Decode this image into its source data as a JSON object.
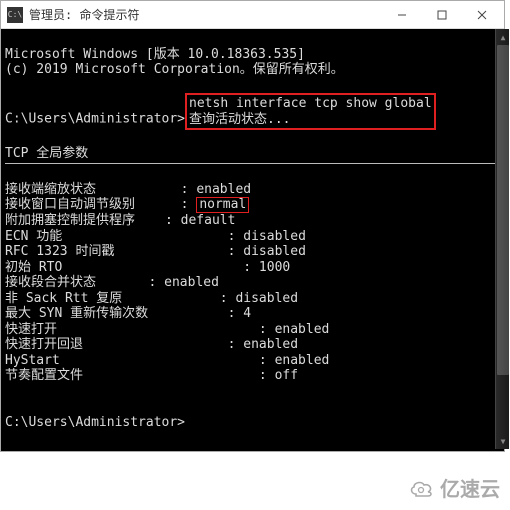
{
  "window": {
    "title": "管理员: 命令提示符"
  },
  "banner": {
    "line1": "Microsoft Windows [版本 10.0.18363.535]",
    "line2": "(c) 2019 Microsoft Corporation。保留所有权利。"
  },
  "prompt": {
    "path": "C:\\Users\\Administrator>",
    "command": "netsh interface tcp show global",
    "status_line": "查询活动状态..."
  },
  "section_header": "TCP 全局参数",
  "rows": {
    "r0_label": "接收端缩放状态",
    "r0_val": "enabled",
    "r1_label": "接收窗口自动调节级别",
    "r1_val": "normal",
    "r2_label": "附加拥塞控制提供程序",
    "r2_val": "default",
    "r3_label": "ECN 功能",
    "r3_val": "disabled",
    "r4_label": "RFC 1323 时间戳",
    "r4_val": "disabled",
    "r5_label": "初始 RTO",
    "r5_val": "1000",
    "r6_label": "接收段合并状态",
    "r6_val": "enabled",
    "r7_label": "非 Sack Rtt 复原",
    "r7_val": "disabled",
    "r8_label": "最大 SYN 重新传输次数",
    "r8_val": "4",
    "r9_label": "快速打开",
    "r9_val": "enabled",
    "r10_label": "快速打开回退",
    "r10_val": "enabled",
    "r11_label": "HyStart",
    "r11_val": "enabled",
    "r12_label": "节奏配置文件",
    "r12_val": "off"
  },
  "prompt2": "C:\\Users\\Administrator>",
  "watermark": "亿速云"
}
